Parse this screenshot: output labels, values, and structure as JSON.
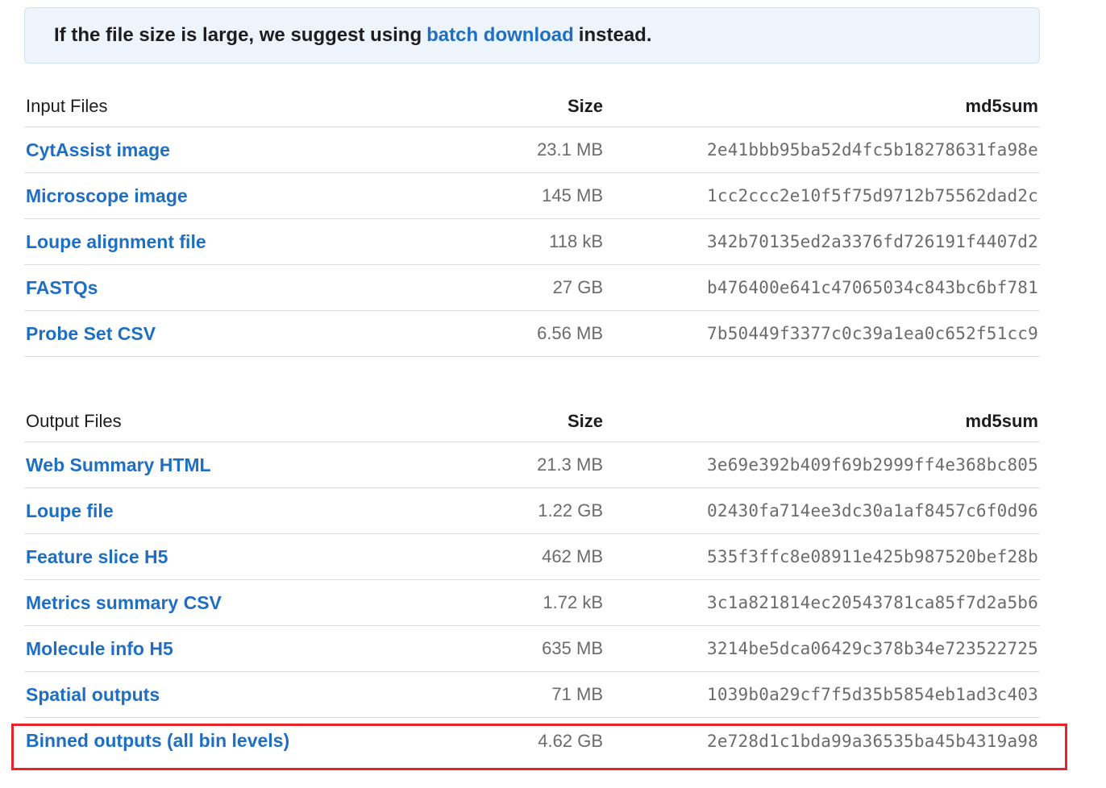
{
  "notice": {
    "prefix": "If the file size is large, we suggest using",
    "link": "batch download",
    "suffix": "instead."
  },
  "input_files": {
    "header": {
      "name": "Input Files",
      "size": "Size",
      "md5": "md5sum"
    },
    "rows": [
      {
        "name": "CytAssist image",
        "size": "23.1 MB",
        "md5": "2e41bbb95ba52d4fc5b18278631fa98e"
      },
      {
        "name": "Microscope image",
        "size": "145 MB",
        "md5": "1cc2ccc2e10f5f75d9712b75562dad2c"
      },
      {
        "name": "Loupe alignment file",
        "size": "118 kB",
        "md5": "342b70135ed2a3376fd726191f4407d2"
      },
      {
        "name": "FASTQs",
        "size": "27 GB",
        "md5": "b476400e641c47065034c843bc6bf781"
      },
      {
        "name": "Probe Set CSV",
        "size": "6.56 MB",
        "md5": "7b50449f3377c0c39a1ea0c652f51cc9"
      }
    ]
  },
  "output_files": {
    "header": {
      "name": "Output Files",
      "size": "Size",
      "md5": "md5sum"
    },
    "rows": [
      {
        "name": "Web Summary HTML",
        "size": "21.3 MB",
        "md5": "3e69e392b409f69b2999ff4e368bc805"
      },
      {
        "name": "Loupe file",
        "size": "1.22 GB",
        "md5": "02430fa714ee3dc30a1af8457c6f0d96"
      },
      {
        "name": "Feature slice H5",
        "size": "462 MB",
        "md5": "535f3ffc8e08911e425b987520bef28b"
      },
      {
        "name": "Metrics summary CSV",
        "size": "1.72 kB",
        "md5": "3c1a821814ec20543781ca85f7d2a5b6"
      },
      {
        "name": "Molecule info H5",
        "size": "635 MB",
        "md5": "3214be5dca06429c378b34e723522725"
      },
      {
        "name": "Spatial outputs",
        "size": "71 MB",
        "md5": "1039b0a29cf7f5d35b5854eb1ad3c403"
      },
      {
        "name": "Binned outputs (all bin levels)",
        "size": "4.62 GB",
        "md5": "2e728d1c1bda99a36535ba45b4319a98"
      }
    ]
  },
  "colors": {
    "link": "#1e6fc4",
    "highlight": "#e8232a",
    "notice_bg": "#eef4fb"
  }
}
